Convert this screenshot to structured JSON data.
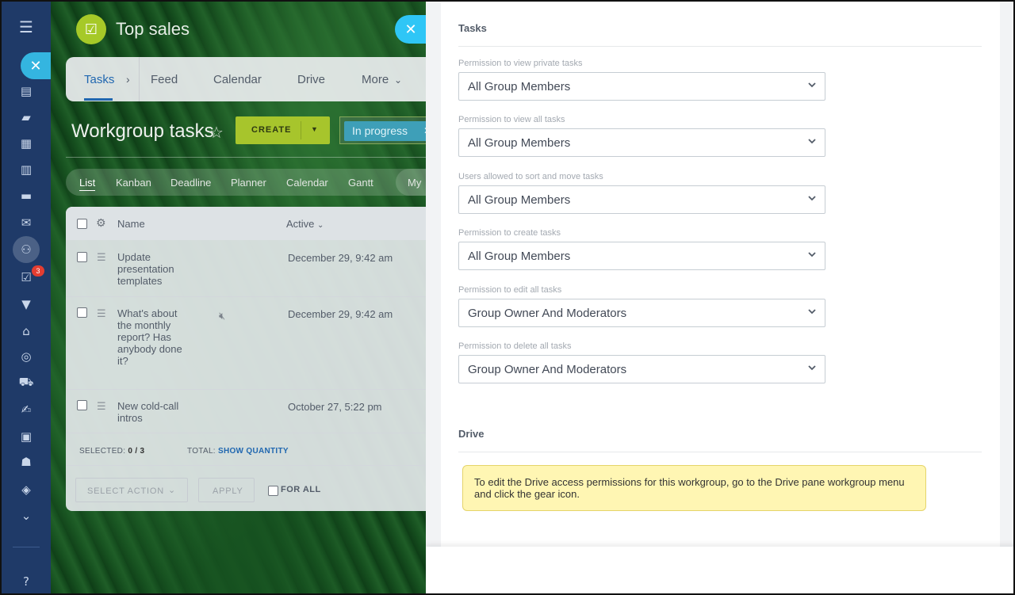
{
  "sidebar": {
    "badge_count": "3",
    "help_glyph": "?"
  },
  "header": {
    "app_title": "Top sales",
    "tabs": [
      {
        "label": "Tasks",
        "active": true
      },
      {
        "label": "Feed"
      },
      {
        "label": "Calendar"
      },
      {
        "label": "Drive"
      },
      {
        "label": "More"
      }
    ]
  },
  "page": {
    "title": "Workgroup tasks",
    "create_label": "CREATE",
    "filter_chip": "In progress"
  },
  "views": [
    "List",
    "Kanban",
    "Deadline",
    "Planner",
    "Calendar",
    "Gantt",
    "My"
  ],
  "grid": {
    "columns": {
      "name": "Name",
      "active": "Active"
    },
    "rows": [
      {
        "name": "Update presentation templates",
        "date": "December 29, 9:42 am"
      },
      {
        "name": "What's about the monthly report? Has anybody done it?",
        "date": "December 29, 9:42 am"
      },
      {
        "name": "New cold-call intros",
        "date": "October 27, 5:22 pm"
      }
    ],
    "selected_label": "SELECTED:",
    "selected_value": "0 / 3",
    "total_label": "TOTAL:",
    "show_quantity": "SHOW QUANTITY",
    "select_action": "SELECT ACTION",
    "apply": "APPLY",
    "for_all": "FOR ALL"
  },
  "panel": {
    "tasks_title": "Tasks",
    "permissions": [
      {
        "label": "Permission to view private tasks",
        "value": "All Group Members"
      },
      {
        "label": "Permission to view all tasks",
        "value": "All Group Members"
      },
      {
        "label": "Users allowed to sort and move tasks",
        "value": "All Group Members"
      },
      {
        "label": "Permission to create tasks",
        "value": "All Group Members"
      },
      {
        "label": "Permission to edit all tasks",
        "value": "Group Owner And Moderators"
      },
      {
        "label": "Permission to delete all tasks",
        "value": "Group Owner And Moderators"
      }
    ],
    "drive_title": "Drive",
    "drive_note": "To edit the Drive access permissions for this workgroup, go to the Drive pane workgroup menu and click the gear icon."
  },
  "colors": {
    "accent": "#2fc6f6",
    "brand_green": "#a7c52c",
    "sidebar_bg": "#1f3a68",
    "notice_bg": "#fff6b3"
  }
}
